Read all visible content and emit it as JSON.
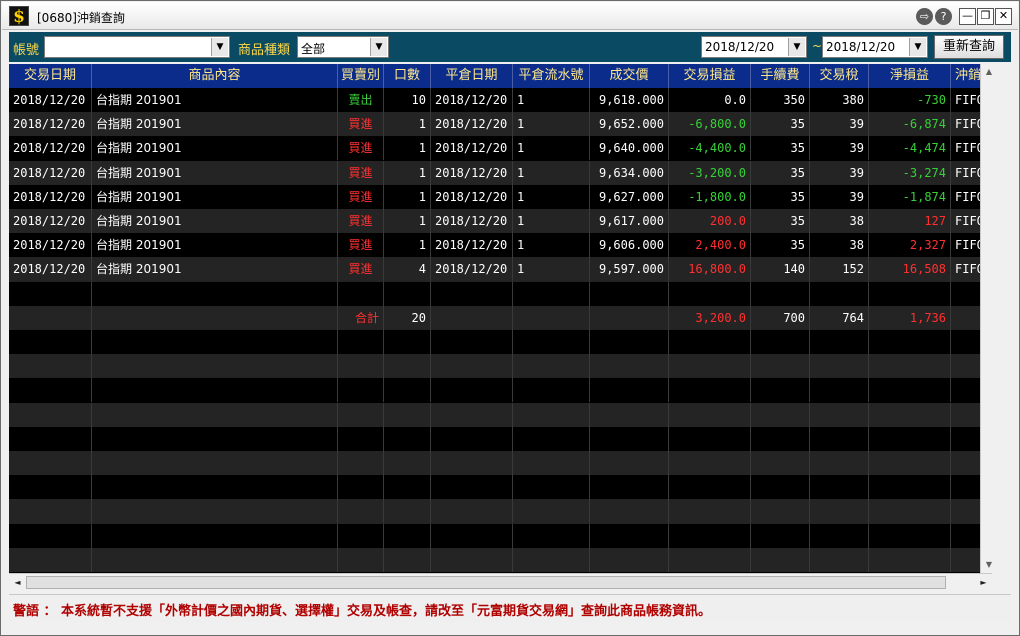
{
  "window": {
    "title": "[0680]沖銷查詢",
    "icon_glyph": "$",
    "controls": {
      "nav": "⇨",
      "help": "?",
      "minimize": "—",
      "restore": "❐",
      "close": "✕"
    }
  },
  "toolbar": {
    "account_label": "帳號",
    "account_value": "",
    "category_label": "商品種類",
    "category_value": "全部",
    "date_from": "2018/12/20",
    "date_sep": "~",
    "date_to": "2018/12/20",
    "requery_label": "重新查詢",
    "dropdown_glyph": "▼"
  },
  "table": {
    "headers": [
      "交易日期",
      "商品內容",
      "買賣別",
      "口數",
      "平倉日期",
      "平倉流水號",
      "成交價",
      "交易損益",
      "手續費",
      "交易稅",
      "淨損益",
      "沖銷類"
    ],
    "rows": [
      {
        "date": "2018/12/20",
        "product": "台指期 201901",
        "side": "賣出",
        "qty": "10",
        "close_date": "2018/12/20",
        "serial": "1",
        "price": "9,618.000",
        "pnl": "0.0",
        "fee": "350",
        "tax": "380",
        "net": "-730",
        "method": "FIFO"
      },
      {
        "date": "2018/12/20",
        "product": "台指期 201901",
        "side": "買進",
        "qty": "1",
        "close_date": "2018/12/20",
        "serial": "1",
        "price": "9,652.000",
        "pnl": "-6,800.0",
        "fee": "35",
        "tax": "39",
        "net": "-6,874",
        "method": "FIFO"
      },
      {
        "date": "2018/12/20",
        "product": "台指期 201901",
        "side": "買進",
        "qty": "1",
        "close_date": "2018/12/20",
        "serial": "1",
        "price": "9,640.000",
        "pnl": "-4,400.0",
        "fee": "35",
        "tax": "39",
        "net": "-4,474",
        "method": "FIFO"
      },
      {
        "date": "2018/12/20",
        "product": "台指期 201901",
        "side": "買進",
        "qty": "1",
        "close_date": "2018/12/20",
        "serial": "1",
        "price": "9,634.000",
        "pnl": "-3,200.0",
        "fee": "35",
        "tax": "39",
        "net": "-3,274",
        "method": "FIFO"
      },
      {
        "date": "2018/12/20",
        "product": "台指期 201901",
        "side": "買進",
        "qty": "1",
        "close_date": "2018/12/20",
        "serial": "1",
        "price": "9,627.000",
        "pnl": "-1,800.0",
        "fee": "35",
        "tax": "39",
        "net": "-1,874",
        "method": "FIFO"
      },
      {
        "date": "2018/12/20",
        "product": "台指期 201901",
        "side": "買進",
        "qty": "1",
        "close_date": "2018/12/20",
        "serial": "1",
        "price": "9,617.000",
        "pnl": "200.0",
        "fee": "35",
        "tax": "38",
        "net": "127",
        "method": "FIFO"
      },
      {
        "date": "2018/12/20",
        "product": "台指期 201901",
        "side": "買進",
        "qty": "1",
        "close_date": "2018/12/20",
        "serial": "1",
        "price": "9,606.000",
        "pnl": "2,400.0",
        "fee": "35",
        "tax": "38",
        "net": "2,327",
        "method": "FIFO"
      },
      {
        "date": "2018/12/20",
        "product": "台指期 201901",
        "side": "買進",
        "qty": "4",
        "close_date": "2018/12/20",
        "serial": "1",
        "price": "9,597.000",
        "pnl": "16,800.0",
        "fee": "140",
        "tax": "152",
        "net": "16,508",
        "method": "FIFO"
      }
    ],
    "total": {
      "label": "合計",
      "qty": "20",
      "pnl": "3,200.0",
      "fee": "700",
      "tax": "764",
      "net": "1,736"
    }
  },
  "colors": {
    "header_bg": "#0b2c8a",
    "header_text": "#ffe78a",
    "toolbar_bg": "#0b4a63",
    "toolbar_label": "#ffd94a",
    "loss": "#38d038",
    "gain": "#ff3030",
    "sell": "#38d038",
    "buy": "#ff3030",
    "warning": "#b00000"
  },
  "scroll": {
    "up": "▲",
    "down": "▼",
    "left": "◄",
    "right": "►"
  },
  "warning": "警語 ： 本系統暫不支援「外幣計價之國內期貨、選擇權」交易及帳查，請改至「元富期貨交易網」查詢此商品帳務資訊。"
}
